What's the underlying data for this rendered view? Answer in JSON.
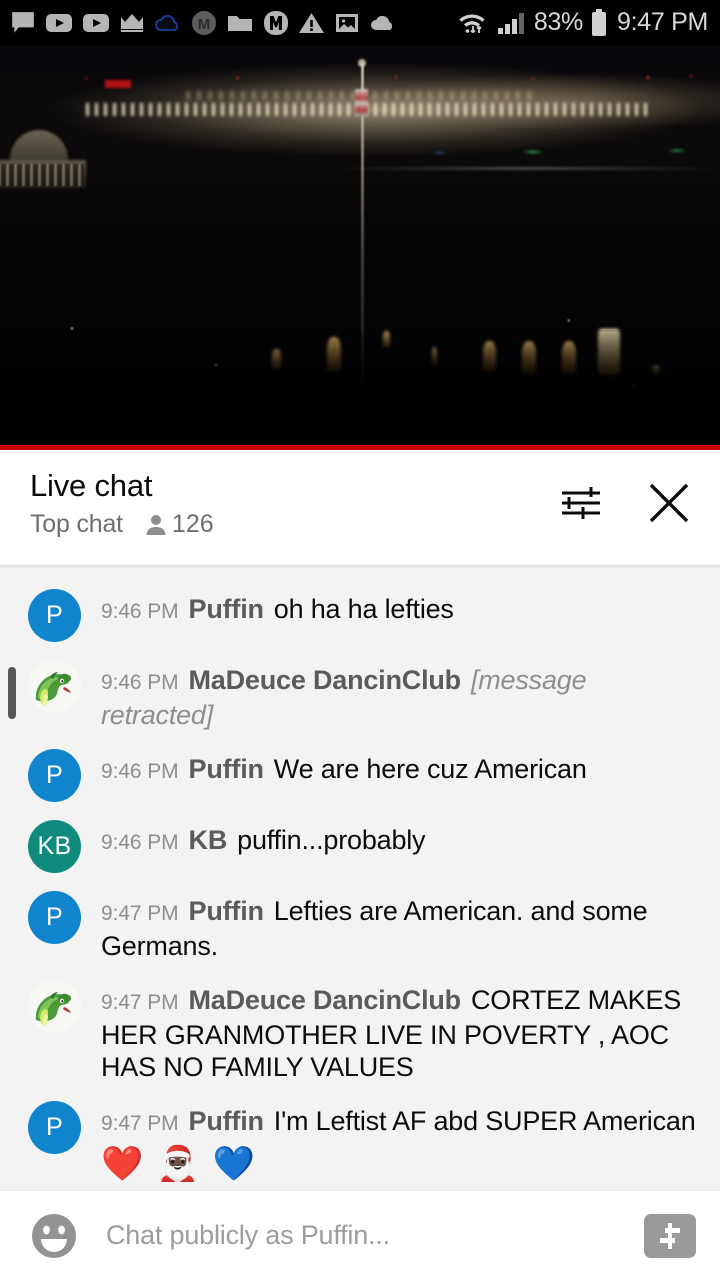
{
  "status_bar": {
    "notification_icons": [
      "chat-bubble-icon",
      "youtube-play-icon",
      "youtube-play-icon",
      "crown-icon",
      "cloud-outline-icon",
      "m-circle-icon",
      "folder-icon",
      "m-badge-icon",
      "warning-triangle-icon",
      "image-icon",
      "cloud-filled-icon"
    ],
    "wifi_icon": "wifi-transfer-icon",
    "signal_icon": "cellular-signal-icon",
    "battery_percent": "83%",
    "battery_icon": "battery-icon",
    "time": "9:47 PM"
  },
  "video": {
    "scene_description": "night cityscape with flagpole",
    "progress_color": "#cc0000"
  },
  "chat_header": {
    "title": "Live chat",
    "mode_label": "Top chat",
    "viewer_icon": "person-icon",
    "viewer_count": "126",
    "settings_icon": "sliders-icon",
    "close_icon": "close-icon"
  },
  "messages": [
    {
      "avatar_type": "letter",
      "avatar_letter": "P",
      "avatar_color": "#1184ce",
      "timestamp": "9:46 PM",
      "author": "Puffin",
      "text": "oh ha ha lefties",
      "retracted": false,
      "emojis": []
    },
    {
      "avatar_type": "image",
      "avatar_letter": "",
      "avatar_color": "#f7f7f4",
      "timestamp": "9:46 PM",
      "author": "MaDeuce DancinClub",
      "text": "[message retracted]",
      "retracted": true,
      "emojis": []
    },
    {
      "avatar_type": "letter",
      "avatar_letter": "P",
      "avatar_color": "#1184ce",
      "timestamp": "9:46 PM",
      "author": "Puffin",
      "text": "We are here cuz American",
      "retracted": false,
      "emojis": []
    },
    {
      "avatar_type": "letter",
      "avatar_letter": "KB",
      "avatar_color": "#0f8b7e",
      "timestamp": "9:46 PM",
      "author": "KB",
      "text": "puffin...probably",
      "retracted": false,
      "emojis": []
    },
    {
      "avatar_type": "letter",
      "avatar_letter": "P",
      "avatar_color": "#1184ce",
      "timestamp": "9:47 PM",
      "author": "Puffin",
      "text": "Lefties are American. and some Germans.",
      "retracted": false,
      "emojis": []
    },
    {
      "avatar_type": "image",
      "avatar_letter": "",
      "avatar_color": "#f7f7f4",
      "timestamp": "9:47 PM",
      "author": "MaDeuce DancinClub",
      "text": "CORTEZ MAKES HER GRANMOTHER LIVE IN POVERTY , AOC HAS NO FAMILY VALUES",
      "retracted": false,
      "emojis": []
    },
    {
      "avatar_type": "letter",
      "avatar_letter": "P",
      "avatar_color": "#1184ce",
      "timestamp": "9:47 PM",
      "author": "Puffin",
      "text": "I'm Leftist AF abd SUPER American",
      "retracted": false,
      "emojis": [
        "❤️",
        "🎅🏿",
        "💙"
      ]
    }
  ],
  "input_bar": {
    "emoji_icon": "emoji-smiley-icon",
    "placeholder": "Chat publicly as Puffin...",
    "superchat_icon": "dollar-superchat-icon"
  }
}
